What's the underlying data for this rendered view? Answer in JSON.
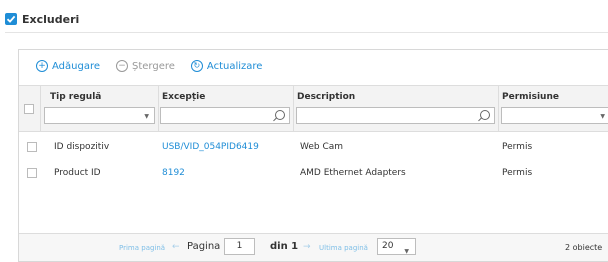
{
  "header": {
    "title": "Excluderi",
    "checked": true
  },
  "toolbar": {
    "add_label": "Adăugare",
    "delete_label": "Ștergere",
    "refresh_label": "Actualizare"
  },
  "columns": [
    {
      "title": "Tip regulă",
      "filter": "select",
      "value": ""
    },
    {
      "title": "Excepție",
      "filter": "search",
      "value": ""
    },
    {
      "title": "Description",
      "filter": "search",
      "value": ""
    },
    {
      "title": "Permisiune",
      "filter": "select",
      "value": ""
    }
  ],
  "rows": [
    {
      "type": "ID dispozitiv",
      "exception": "USB/VID_054PID6419",
      "description": "Web Cam",
      "permission": "Permis"
    },
    {
      "type": "Product ID",
      "exception": "8192",
      "description": "AMD Ethernet Adapters",
      "permission": "Permis"
    }
  ],
  "pager": {
    "first_label": "Prima pagină",
    "page_label": "Pagina",
    "current_page": "1",
    "of_label": "din 1",
    "last_label": "Ultima pagină",
    "page_size": "20",
    "total": "2 obiecte"
  },
  "colors": {
    "accent": "#1f8dd6",
    "header_bg": "#f3f3f3",
    "border": "#d8d8d8"
  }
}
